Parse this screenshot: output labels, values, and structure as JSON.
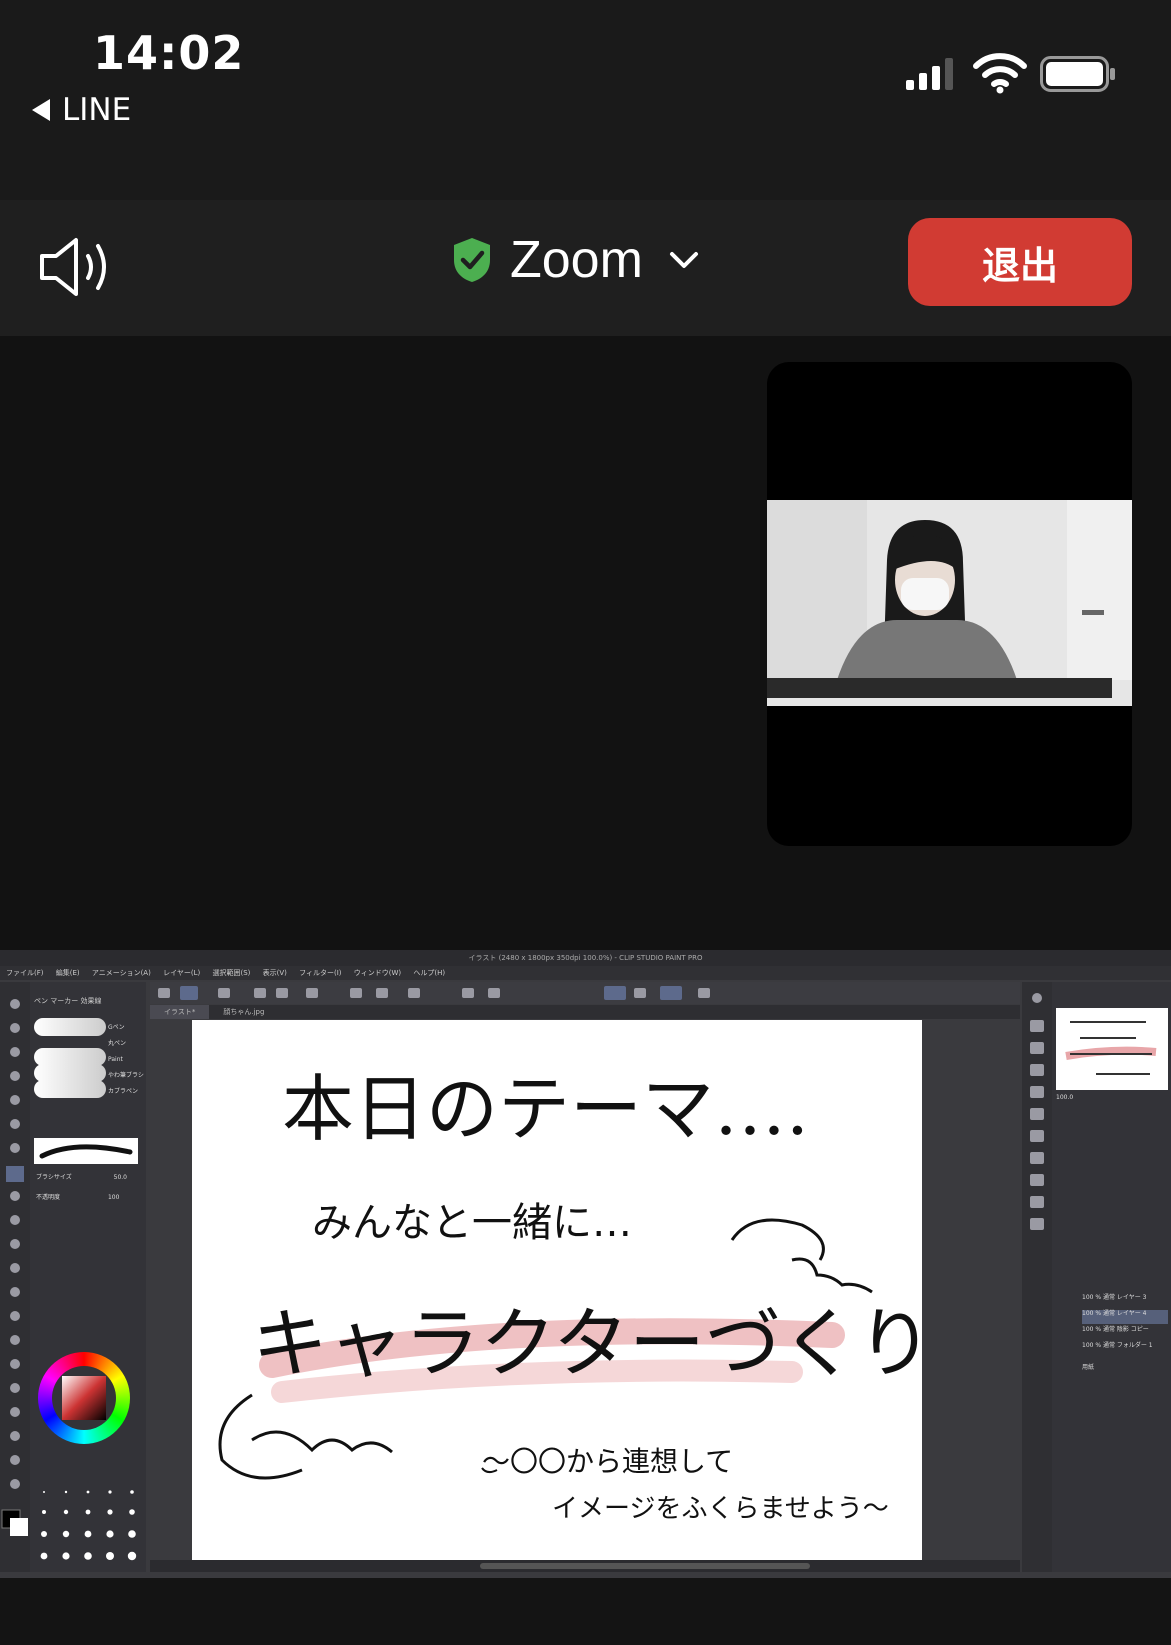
{
  "status_bar": {
    "time": "14:02",
    "back_app": "LINE",
    "icons": [
      "cellular-signal-icon",
      "wifi-icon",
      "battery-icon"
    ]
  },
  "zoom_header": {
    "title": "Zoom",
    "leave_label": "退出",
    "icons": [
      "speaker-icon",
      "shield-check-icon",
      "chevron-down-icon"
    ],
    "colors": {
      "leave": "#d13b33",
      "shield": "#4caf50"
    }
  },
  "shared_screen": {
    "app_title": "イラスト (2480 x 1800px 350dpi 100.0%) - CLIP STUDIO PAINT PRO",
    "menu": [
      "ファイル(F)",
      "編集(E)",
      "アニメーション(A)",
      "レイヤー(L)",
      "選択範囲(S)",
      "表示(V)",
      "フィルター(I)",
      "ウィンドウ(W)",
      "ヘルプ(H)"
    ],
    "tabs": [
      "イラスト*",
      "顔ちゃん.jpg"
    ],
    "sub_tool_tabs": [
      "ペン",
      "マーカー",
      "効果線"
    ],
    "brushes": [
      "Gペン",
      "丸ペン",
      "Paint",
      "やわ筆ブラシ",
      "カブラペン"
    ],
    "brush_size_label": "ブラシサイズ",
    "brush_size_value": "50.0",
    "opacity_label": "不透明度",
    "opacity_value": "100",
    "zoom_value": "100.0",
    "layers": [
      "100 % 通常 レイヤー 3",
      "100 % 通常 レイヤー 4",
      "100 % 通常 陰影 コピー",
      "100 % 通常 フォルダー 1",
      "用紙"
    ],
    "canvas_text": {
      "line1": "本日のテーマ….",
      "line2": "みんなと一緒に…",
      "line3": "キャラクターづくり",
      "line4": "〜〇〇から連想して",
      "line5": "イメージをふくらませよう〜"
    }
  }
}
